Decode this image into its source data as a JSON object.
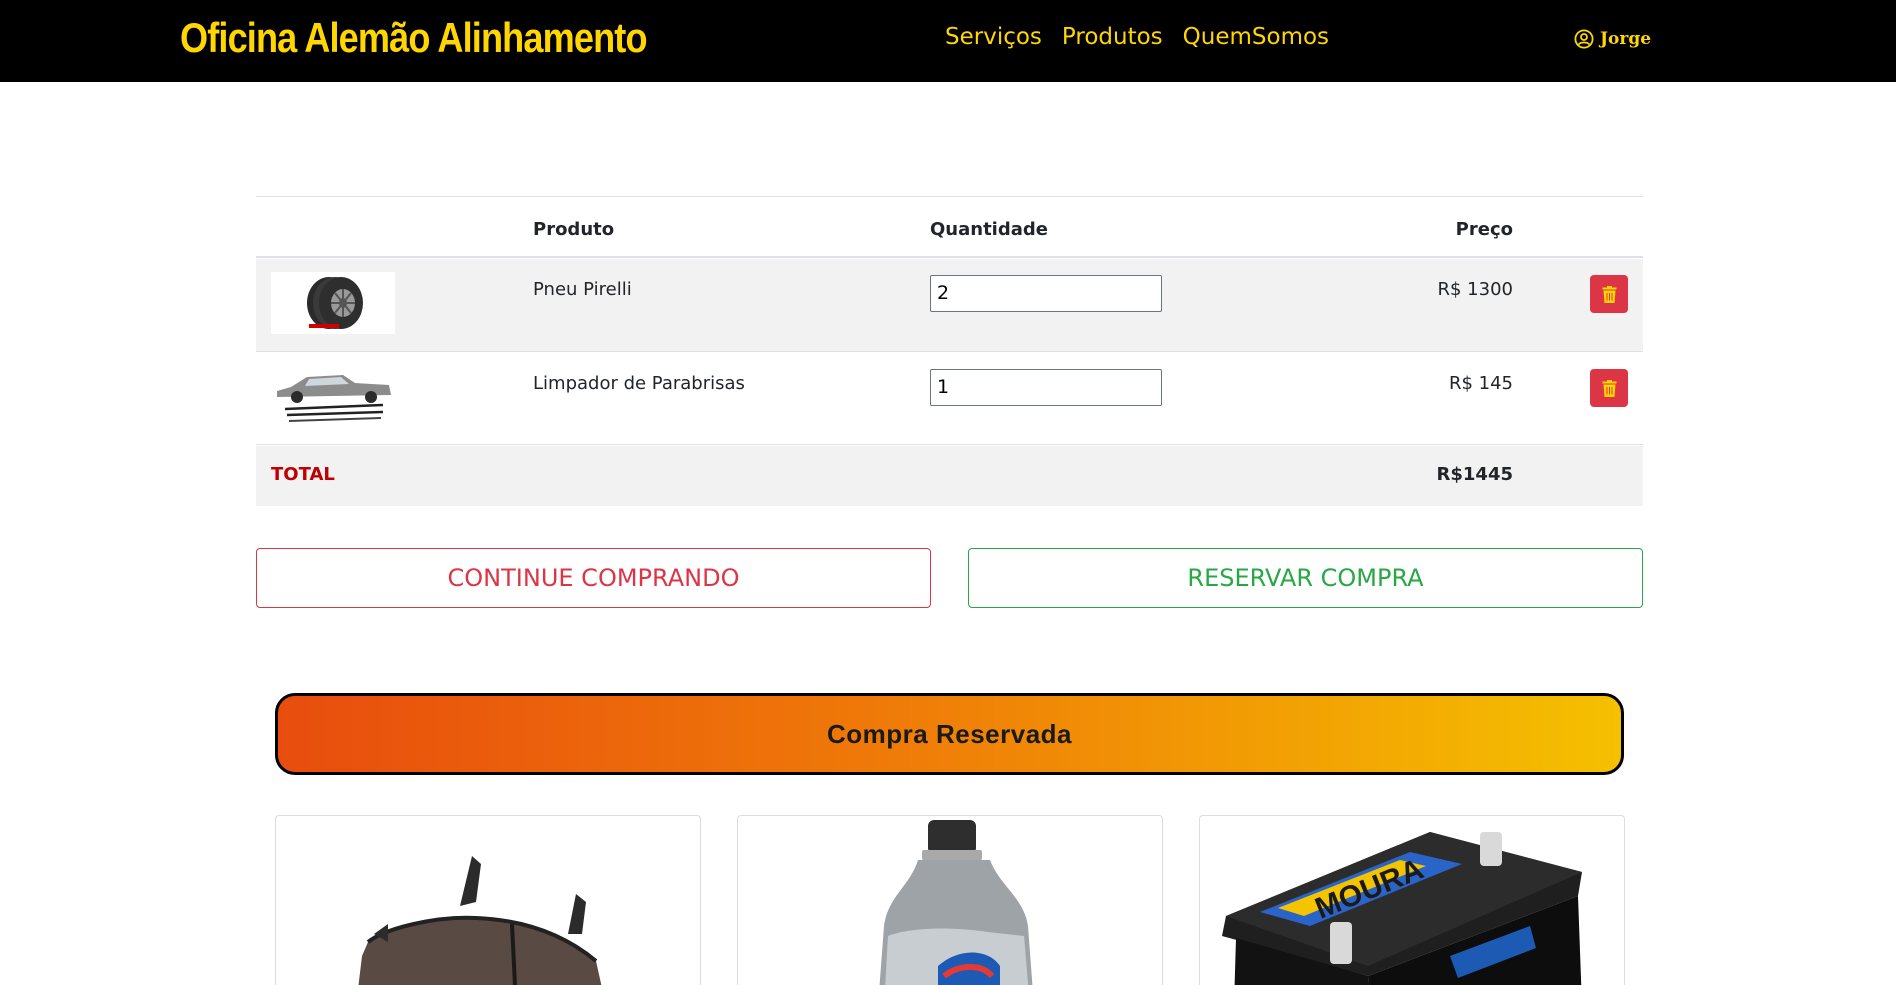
{
  "navbar": {
    "brand": "Oficina Alemão Alinhamento",
    "links": [
      "Serviços",
      "Produtos",
      "QuemSomos"
    ],
    "user": "Jorge",
    "user_icon": "user-circle-icon",
    "colors": {
      "background": "#000000",
      "text": "#ffd600"
    }
  },
  "cart": {
    "headers": {
      "product": "Produto",
      "quantity": "Quantidade",
      "price": "Preço"
    },
    "items": [
      {
        "name": "Pneu Pirelli",
        "quantity": "2",
        "price": "R$ 1300",
        "image": "tire-image"
      },
      {
        "name": "Limpador de Parabrisas",
        "quantity": "1",
        "price": "R$ 145",
        "image": "wiper-image"
      }
    ],
    "delete_icon": "trash-icon",
    "total_label": "TOTAL",
    "total_value": "R$1445"
  },
  "actions": {
    "continue_label": "CONTINUE COMPRANDO",
    "reserve_label": "RESERVAR COMPRA"
  },
  "reserved": {
    "title": "Compra Reservada",
    "products": [
      {
        "image": "brake-pad-image"
      },
      {
        "image": "oil-bottle-image"
      },
      {
        "image": "moura-battery-image",
        "brand_text": "MOURA"
      }
    ]
  },
  "colors": {
    "danger": "#dc3545",
    "success": "#28a745",
    "total_label": "#c00000",
    "banner_start": "#e84d0e",
    "banner_end": "#f5c000"
  }
}
